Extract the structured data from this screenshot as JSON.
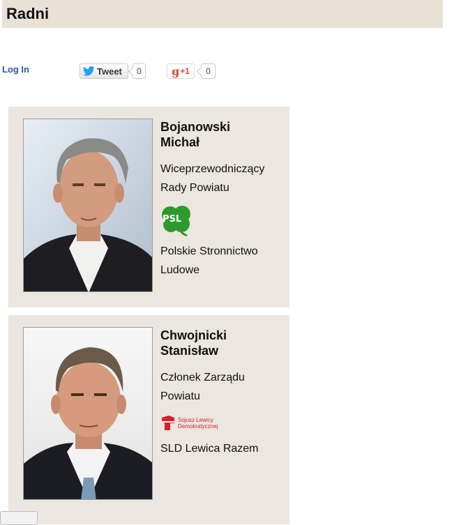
{
  "page": {
    "title": "Radni"
  },
  "toolbar": {
    "login_label": "Log In",
    "tweet_label": "Tweet",
    "tweet_count": "0",
    "gplus_label": "+1",
    "gplus_g": "g",
    "gplus_count": "0"
  },
  "councillors": [
    {
      "name_line1": "Bojanowski",
      "name_line2": "Michał",
      "role_line1": "Wiceprzewodniczący",
      "role_line2": "Rady Powiatu",
      "party_logo_text": "PSL",
      "party_line1": "Polskie Stronnictwo",
      "party_line2": "Ludowe"
    },
    {
      "name_line1": "Chwojnicki",
      "name_line2": "Stanisław",
      "role_line1": "Członek Zarządu",
      "role_line2": "Powiatu",
      "party_logo_text": "Sojusz Lewicy Demokratycznej",
      "party_logo_text_line1": "Sojusz Lewicy",
      "party_logo_text_line2": "Demokratycznej",
      "party_line1": "SLD Lewica Razem"
    }
  ],
  "colors": {
    "header_bg": "#e9e1d6",
    "card_bg": "#ebe6df",
    "link": "#2a56a6",
    "psl_green": "#2e9a2e",
    "sld_red": "#d3222a",
    "twitter_blue": "#1da1f2",
    "gplus_red": "#d6492f"
  }
}
